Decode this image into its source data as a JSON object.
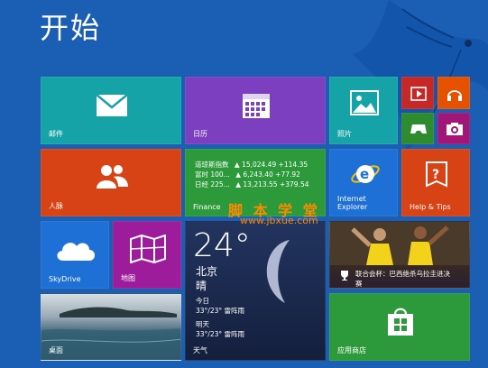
{
  "screen": {
    "title": "开始"
  },
  "tiles": {
    "mail": {
      "label": "邮件",
      "color": "#16a3a8"
    },
    "calendar": {
      "label": "日历",
      "color": "#7b3fbf"
    },
    "photos": {
      "label": "照片",
      "color": "#16a3a8"
    },
    "video": {
      "color": "#c62828"
    },
    "music": {
      "color": "#e65100"
    },
    "games": {
      "color": "#2e8b2e"
    },
    "camera": {
      "color": "#a11677"
    },
    "people": {
      "label": "人脉",
      "color": "#d84315"
    },
    "finance": {
      "label": "Finance",
      "color": "#2c9a3a",
      "rows": [
        {
          "name": "道琼斯指数",
          "value": "▲ 15,024.49 +114.35"
        },
        {
          "name": "富时 100...",
          "value": "▲ 6,243.40 +77.92"
        },
        {
          "name": "日经 225...",
          "value": "▲ 13,213.55 +379.54"
        }
      ]
    },
    "ie": {
      "label": "Internet Explorer",
      "color": "#1e6fd6"
    },
    "help": {
      "label": "Help & Tips",
      "color": "#d84315"
    },
    "skydrive": {
      "label": "SkyDrive",
      "color": "#1e6fd6"
    },
    "maps": {
      "label": "地图",
      "color": "#9c1c9c"
    },
    "weather": {
      "temp": "24°",
      "city": "北京",
      "condition": "晴",
      "today_label": "今日",
      "today_value": "33°/23° 雷阵雨",
      "tomorrow_label": "明天",
      "tomorrow_value": "33°/23° 雷阵雨",
      "label": "天气",
      "color": "#1a2a55"
    },
    "sports": {
      "headline": "联合会杯：巴西绝杀乌拉圭进决赛",
      "color": "#3c2255"
    },
    "desktop": {
      "label": "桌面"
    },
    "store": {
      "label": "应用商店",
      "color": "#2c9a3a"
    }
  },
  "watermark": {
    "text": "脚 本 学 堂",
    "url": "www.jbxue.com"
  }
}
